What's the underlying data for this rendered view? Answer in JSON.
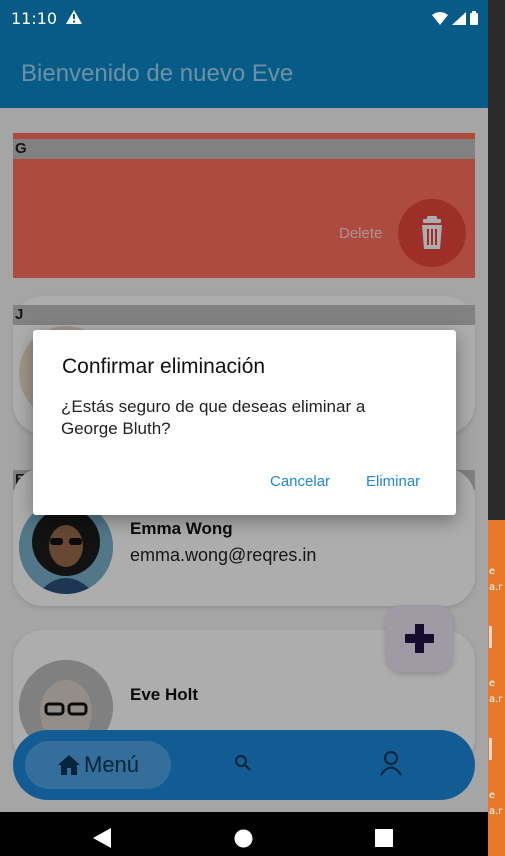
{
  "status": {
    "time": "11:10"
  },
  "app_bar": {
    "title": "Bienvenido de nuevo Eve"
  },
  "sections": [
    {
      "letter": "G"
    },
    {
      "letter": "J"
    },
    {
      "letter": "E"
    }
  ],
  "swipe_action": {
    "label": "Delete"
  },
  "contacts": [
    {
      "name": "Emma Wong",
      "email": "emma.wong@reqres.in"
    },
    {
      "name": "Eve Holt",
      "email": ""
    }
  ],
  "bottom_nav": {
    "home_label": "Menú"
  },
  "dialog": {
    "title": "Confirmar eliminación",
    "message": "¿Estás seguro de que deseas eliminar a George Bluth?",
    "cancel_label": "Cancelar",
    "confirm_label": "Eliminar"
  },
  "desktop_strip": {
    "items": [
      "e",
      "a.r",
      "e",
      "a.r",
      "e",
      "a.r"
    ]
  },
  "colors": {
    "primary": "#0b88c8",
    "status_bar": "#075b86",
    "delete_bg": "#ff6f61",
    "accent_text": "#1e88d6",
    "nav": "#1b88d9"
  }
}
